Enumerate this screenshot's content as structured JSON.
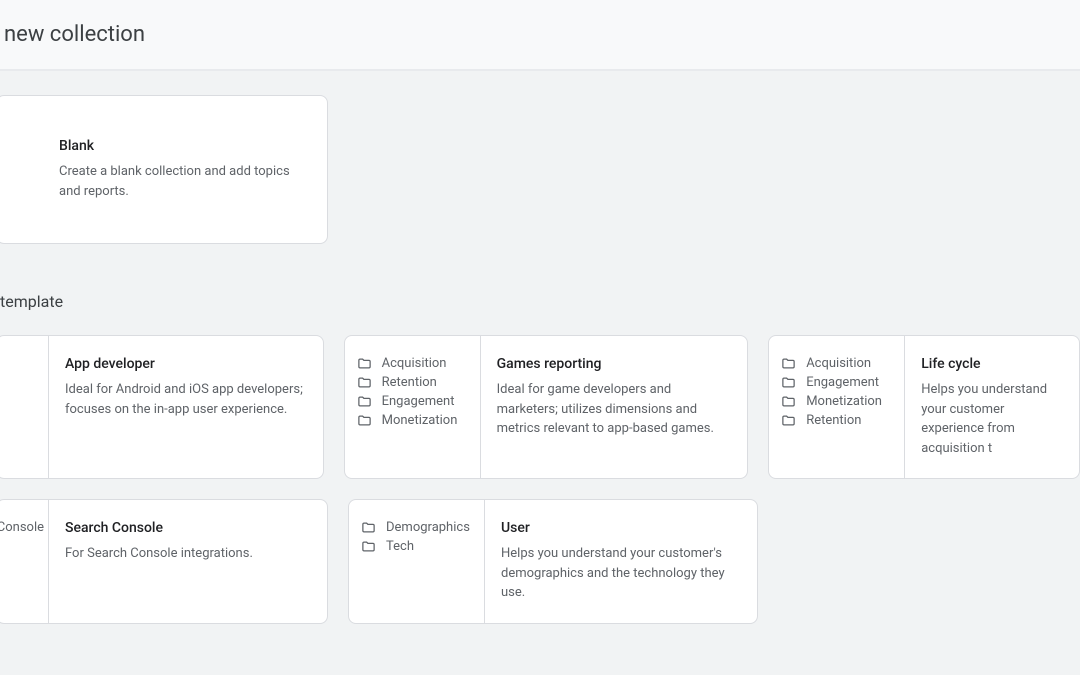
{
  "header": {
    "title": "new collection"
  },
  "blank": {
    "title": "Blank",
    "desc": "Create a blank collection and add topics and reports."
  },
  "section_label": "template",
  "cards": {
    "app_developer": {
      "title": "App developer",
      "desc": "Ideal for Android and iOS app developers; focuses on the in-app user experience."
    },
    "games": {
      "title": "Games reporting",
      "desc": "Ideal for game developers and marketers; utilizes dimensions and metrics relevant to app-based games.",
      "items": [
        "Acquisition",
        "Retention",
        "Engagement",
        "Monetization"
      ]
    },
    "life_cycle": {
      "title": "Life cycle",
      "desc": "Helps you understand your customer experience from acquisition t",
      "items": [
        "Acquisition",
        "Engagement",
        "Monetization",
        "Retention"
      ]
    },
    "search_console": {
      "title": "Search Console",
      "desc": "For Search Console integrations.",
      "left_label": "Console"
    },
    "user": {
      "title": "User",
      "desc": "Helps you understand your customer's demographics and the technology they use.",
      "items": [
        "Demographics",
        "Tech"
      ]
    }
  }
}
